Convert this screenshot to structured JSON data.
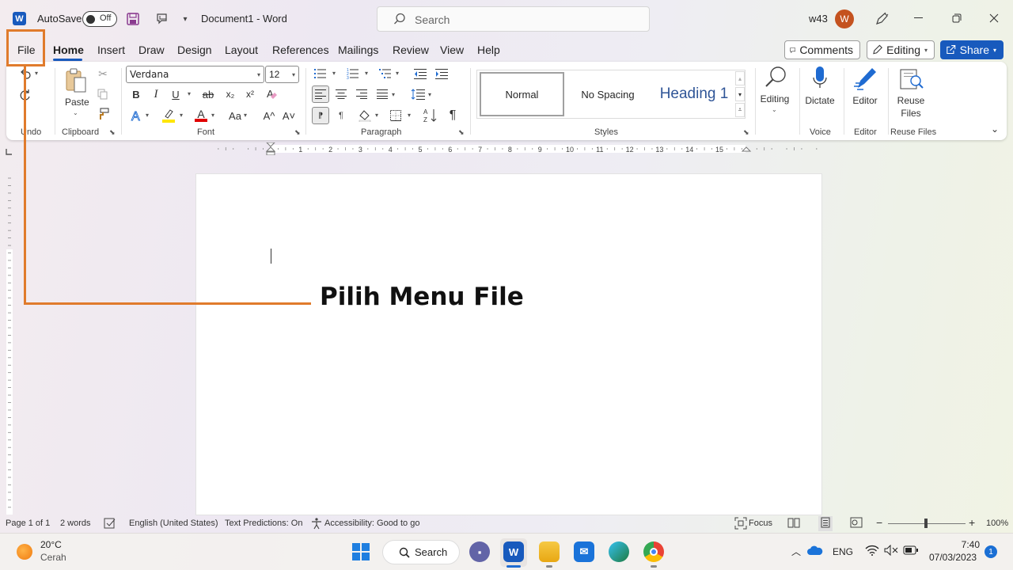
{
  "titlebar": {
    "autosave_label": "AutoSave",
    "autosave_state": "Off",
    "doc_title": "Document1  -  Word",
    "search_placeholder": "Search",
    "user": "w43",
    "avatar_initial": "W"
  },
  "tabs": [
    "File",
    "Home",
    "Insert",
    "Draw",
    "Design",
    "Layout",
    "References",
    "Mailings",
    "Review",
    "View",
    "Help"
  ],
  "active_tab": "Home",
  "top_buttons": {
    "comments": "Comments",
    "editing": "Editing",
    "share": "Share"
  },
  "ribbon": {
    "groups": {
      "undo": "Undo",
      "clipboard": "Clipboard",
      "font": "Font",
      "paragraph": "Paragraph",
      "styles": "Styles",
      "voice": "Voice",
      "editor": "Editor",
      "reuse": "Reuse Files"
    },
    "paste_label": "Paste",
    "font_name": "Verdana",
    "font_size": "12",
    "styles": [
      "Normal",
      "No Spacing",
      "Heading 1"
    ],
    "editing_label": "Editing",
    "dictate_label": "Dictate",
    "editor_label": "Editor",
    "reuse_label_1": "Reuse",
    "reuse_label_2": "Files",
    "font_buttons": {
      "bold": "B",
      "italic": "I",
      "underline": "U",
      "strike": "ab",
      "subscript": "x₂",
      "superscript": "x²",
      "font_color_letter": "A",
      "change_case": "Aa",
      "grow": "A^",
      "shrink": "A˅"
    }
  },
  "ruler": {
    "labels": [
      "1",
      "2",
      "3",
      "4",
      "5",
      "6",
      "7",
      "8",
      "9",
      "10",
      "11",
      "12",
      "13",
      "14",
      "15"
    ]
  },
  "annotation": {
    "text": "Pilih Menu File",
    "color": "#e07b2c"
  },
  "statusbar": {
    "page": "Page 1 of 1",
    "words": "2 words",
    "language": "English (United States)",
    "predictions": "Text Predictions: On",
    "accessibility": "Accessibility: Good to go",
    "focus": "Focus",
    "zoom": "100%"
  },
  "taskbar": {
    "weather_temp": "20°C",
    "weather_desc": "Cerah",
    "search_label": "Search",
    "lang": "ENG",
    "time": "7:40",
    "date": "07/03/2023",
    "notifications": "1"
  },
  "colors": {
    "accent": "#185abd",
    "annotation": "#e07b2c"
  }
}
